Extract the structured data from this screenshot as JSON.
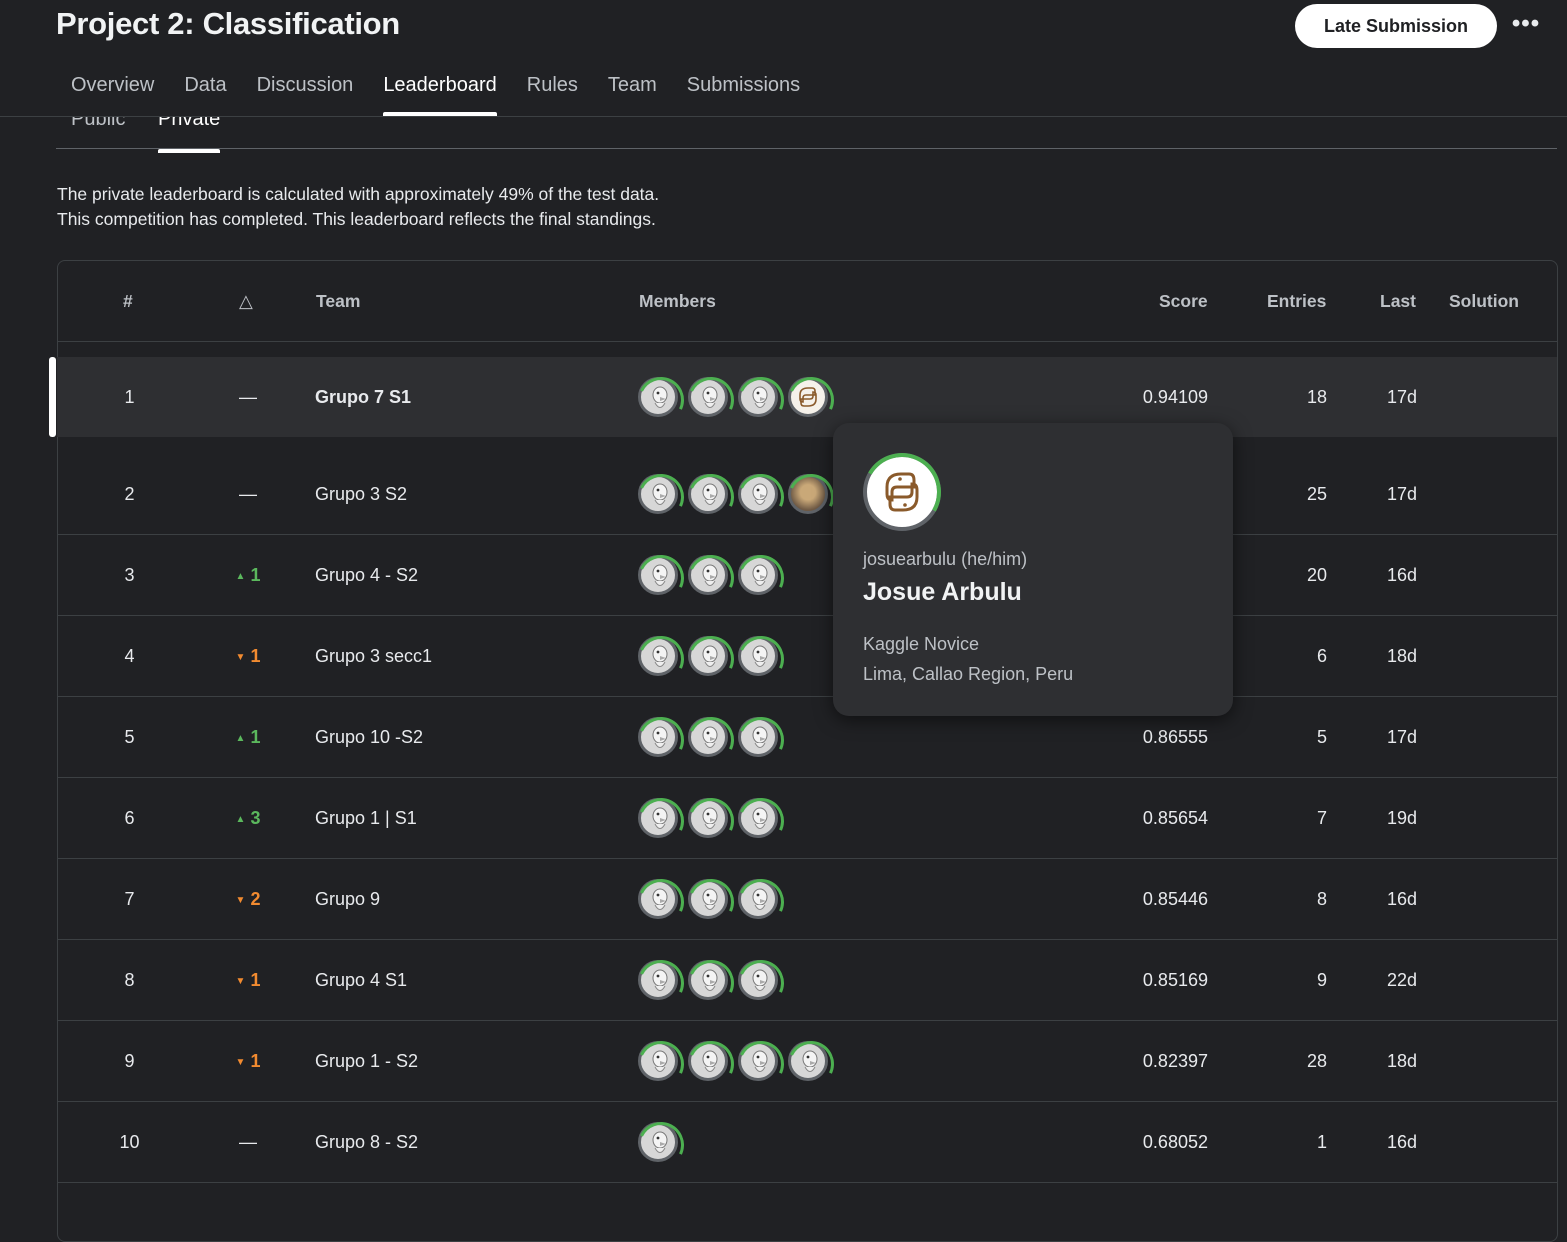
{
  "header": {
    "title": "Project 2: Classification",
    "late_submission_label": "Late Submission",
    "more_label": "•••"
  },
  "tabs": [
    "Overview",
    "Data",
    "Discussion",
    "Leaderboard",
    "Rules",
    "Team",
    "Submissions"
  ],
  "active_tab": "Leaderboard",
  "subtabs": [
    "Public",
    "Private"
  ],
  "active_subtab": "Private",
  "info": {
    "line1": "The private leaderboard is calculated with approximately 49% of the test data.",
    "line2": "This competition has completed. This leaderboard reflects the final standings."
  },
  "columns": {
    "rank": "#",
    "delta": "△",
    "team": "Team",
    "members": "Members",
    "score": "Score",
    "entries": "Entries",
    "last": "Last",
    "solution": "Solution"
  },
  "rows": [
    {
      "rank": "1",
      "delta": "—",
      "delta_dir": "same",
      "team": "Grupo 7 S1",
      "members": [
        "goose",
        "goose",
        "goose",
        "python"
      ],
      "score": "0.94109",
      "entries": "18",
      "last": "17d"
    },
    {
      "rank": "2",
      "delta": "—",
      "delta_dir": "same",
      "team": "Grupo 3 S2",
      "members": [
        "goose",
        "goose",
        "goose",
        "photo"
      ],
      "score": "",
      "entries": "25",
      "last": "17d"
    },
    {
      "rank": "3",
      "delta": "1",
      "delta_dir": "up",
      "team": "Grupo 4 - S2",
      "members": [
        "goose",
        "goose",
        "goose"
      ],
      "score": "",
      "entries": "20",
      "last": "16d"
    },
    {
      "rank": "4",
      "delta": "1",
      "delta_dir": "down",
      "team": "Grupo 3 secc1",
      "members": [
        "goose",
        "goose",
        "goose"
      ],
      "score": "",
      "entries": "6",
      "last": "18d"
    },
    {
      "rank": "5",
      "delta": "1",
      "delta_dir": "up",
      "team": "Grupo 10 -S2",
      "members": [
        "goose",
        "goose",
        "goose"
      ],
      "score": "0.86555",
      "entries": "5",
      "last": "17d"
    },
    {
      "rank": "6",
      "delta": "3",
      "delta_dir": "up",
      "team": "Grupo 1 | S1",
      "members": [
        "goose",
        "goose",
        "goose"
      ],
      "score": "0.85654",
      "entries": "7",
      "last": "19d"
    },
    {
      "rank": "7",
      "delta": "2",
      "delta_dir": "down",
      "team": "Grupo 9",
      "members": [
        "goose",
        "goose",
        "goose"
      ],
      "score": "0.85446",
      "entries": "8",
      "last": "16d"
    },
    {
      "rank": "8",
      "delta": "1",
      "delta_dir": "down",
      "team": "Grupo 4 S1",
      "members": [
        "goose",
        "goose",
        "goose"
      ],
      "score": "0.85169",
      "entries": "9",
      "last": "22d"
    },
    {
      "rank": "9",
      "delta": "1",
      "delta_dir": "down",
      "team": "Grupo 1 - S2",
      "members": [
        "goose",
        "goose",
        "goose",
        "goose"
      ],
      "score": "0.82397",
      "entries": "28",
      "last": "18d"
    },
    {
      "rank": "10",
      "delta": "—",
      "delta_dir": "same",
      "team": "Grupo 8 - S2",
      "members": [
        "goose"
      ],
      "score": "0.68052",
      "entries": "1",
      "last": "16d"
    }
  ],
  "tooltip": {
    "username": "josuearbulu (he/him)",
    "name": "Josue Arbulu",
    "tier": "Kaggle Novice",
    "location": "Lima, Callao Region, Peru"
  },
  "colors": {
    "background": "#202124",
    "rank_up": "#5bb85d",
    "rank_down": "#f28b30",
    "progress_ring": "#4caf50"
  }
}
